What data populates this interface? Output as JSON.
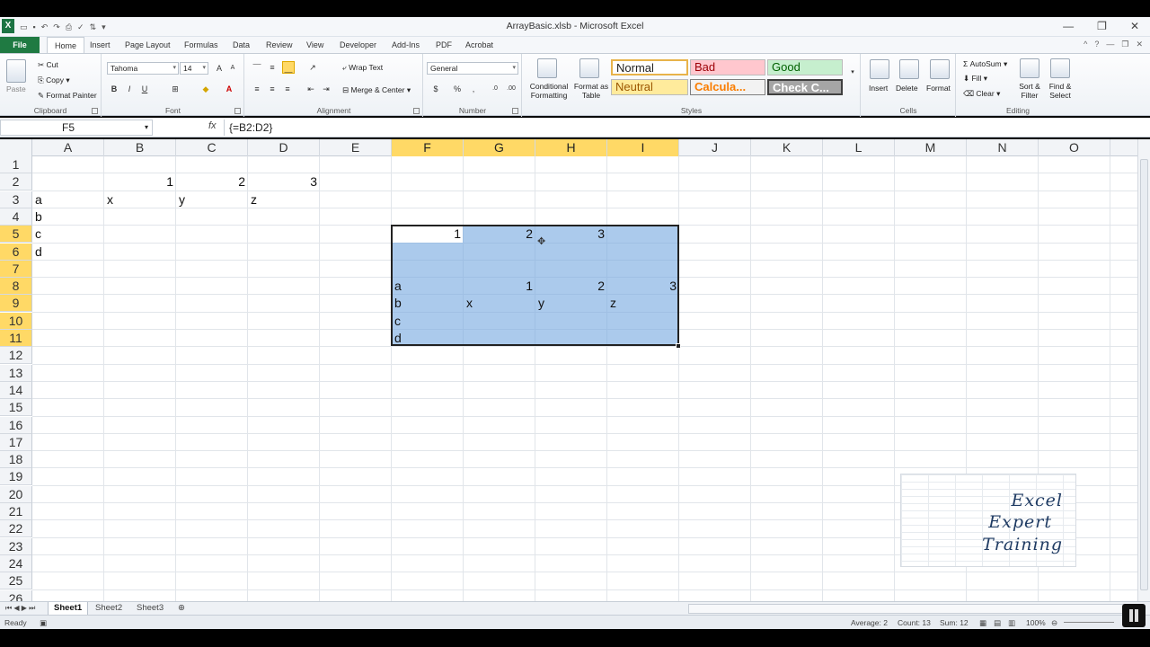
{
  "window": {
    "title": "ArrayBasic.xlsb - Microsoft Excel"
  },
  "ribbon_tabs": [
    "File",
    "Home",
    "Insert",
    "Page Layout",
    "Formulas",
    "Data",
    "Review",
    "View",
    "Developer",
    "Add-Ins",
    "PDF",
    "Acrobat"
  ],
  "clipboard": {
    "paste": "Paste",
    "cut": "Cut",
    "copy": "Copy",
    "format_painter": "Format Painter",
    "label": "Clipboard"
  },
  "font": {
    "name": "Tahoma",
    "size": "14",
    "label": "Font"
  },
  "alignment": {
    "wrap_text": "Wrap Text",
    "merge_center": "Merge & Center",
    "label": "Alignment"
  },
  "number": {
    "format": "General",
    "label": "Number"
  },
  "styles": {
    "conditional": "Conditional Formatting",
    "format_as_table": "Format as Table",
    "normal": "Normal",
    "bad": "Bad",
    "good": "Good",
    "neutral": "Neutral",
    "calculation": "Calcula...",
    "check_cell": "Check C...",
    "label": "Styles"
  },
  "cells_group": {
    "insert": "Insert",
    "delete": "Delete",
    "format": "Format",
    "label": "Cells"
  },
  "editing": {
    "autosum": "AutoSum",
    "fill": "Fill",
    "clear": "Clear",
    "sort_filter": "Sort & Filter",
    "find_select": "Find & Select",
    "label": "Editing"
  },
  "formula_bar": {
    "name_box": "F5",
    "fx": "fx",
    "formula": "{=B2:D2}"
  },
  "columns": [
    "A",
    "B",
    "C",
    "D",
    "E",
    "F",
    "G",
    "H",
    "I",
    "J",
    "K",
    "L",
    "M",
    "N",
    "O"
  ],
  "rows": [
    "1",
    "2",
    "3",
    "4",
    "5",
    "6",
    "7",
    "8",
    "9",
    "10",
    "11",
    "12",
    "13",
    "14",
    "15",
    "16",
    "17",
    "18",
    "19",
    "20",
    "21",
    "22",
    "23",
    "24",
    "25",
    "26"
  ],
  "cells": {
    "B2": "1",
    "C2": "2",
    "D2": "3",
    "A3": "a",
    "B3": "x",
    "C3": "y",
    "D3": "z",
    "A4": "b",
    "A5": "c",
    "A6": "d",
    "F5": "1",
    "G5": "2",
    "H5": "3",
    "F8": "a",
    "G8": "1",
    "H8": "2",
    "I8": "3",
    "F9": "b",
    "G9": "x",
    "H9": "y",
    "I9": "z",
    "F10": "c",
    "F11": "d"
  },
  "logo": {
    "line1": "Excel",
    "line2": "Expert",
    "line3": "Training"
  },
  "sheets": [
    "Sheet1",
    "Sheet2",
    "Sheet3"
  ],
  "status": {
    "mode": "Ready",
    "average": "Average: 2",
    "count": "Count: 13",
    "sum": "Sum: 12",
    "zoom": "100%"
  }
}
